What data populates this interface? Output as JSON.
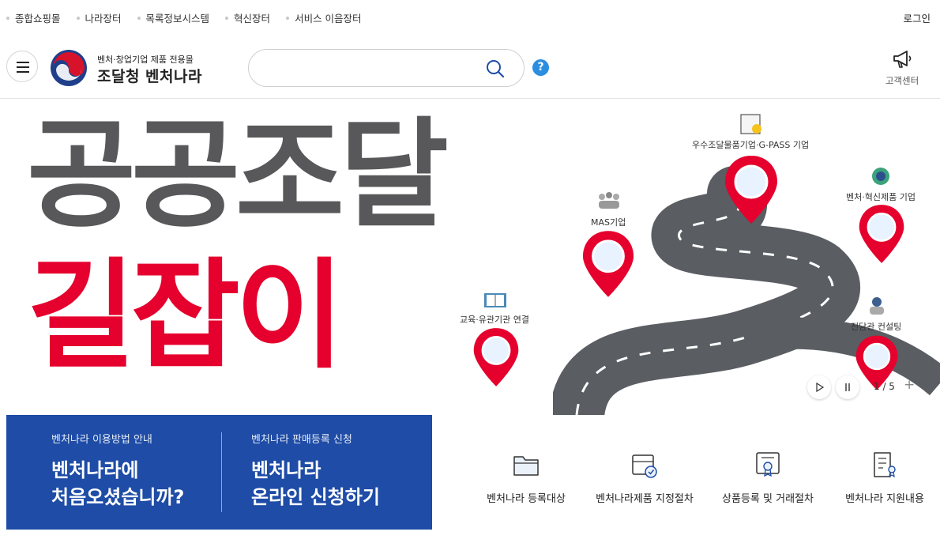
{
  "topbar": {
    "links": [
      "종합쇼핑몰",
      "나라장터",
      "목록정보시스템",
      "혁신장터",
      "서비스 이음장터"
    ],
    "login": "로그인"
  },
  "header": {
    "logo_sub": "벤처·창업기업 제품 전용몰",
    "logo_main": "조달청 벤처나라",
    "search_value": "",
    "help_label": "?",
    "customer_center": "고객센터"
  },
  "hero": {
    "title_line1": "공공조달",
    "title_line2": "길잡이",
    "pins": [
      "우수조달물품기업·G-PASS 기업",
      "MAS기업",
      "벤처·혁신제품 기업",
      "교육·유관기관 연결",
      "전담관 컨설팅"
    ],
    "pager": "1 / 5",
    "plus": "+"
  },
  "banner": {
    "left_small": "벤처나라 이용방법 안내",
    "left_big1": "벤처나라에",
    "left_big2": "처음오셨습니까?",
    "right_small": "벤처나라 판매등록 신청",
    "right_big1": "벤처나라",
    "right_big2": "온라인 신청하기"
  },
  "quick_links": [
    "벤처나라 등록대상",
    "벤처나라제품 지정절차",
    "상품등록 및 거래절차",
    "벤처나라 지원내용"
  ],
  "colors": {
    "accent_red": "#e5002d",
    "title_gray": "#58585a",
    "banner_blue": "#1e4ca6",
    "help_blue": "#2b8ee0"
  }
}
